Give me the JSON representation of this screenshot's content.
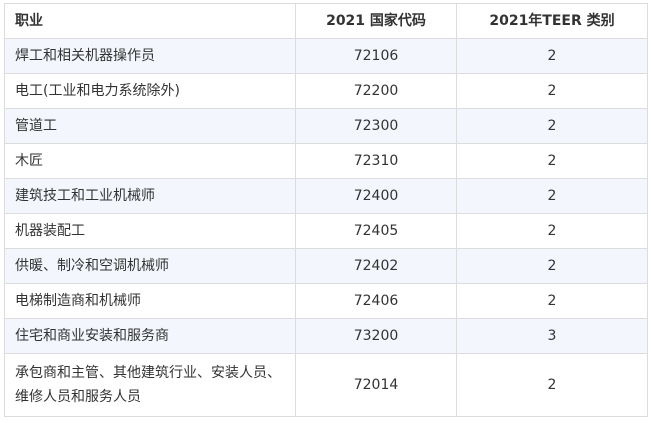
{
  "table": {
    "headers": {
      "occupation": "职业",
      "code": "2021 国家代码",
      "teer": "2021年TEER 类别"
    },
    "rows": [
      {
        "occupation": "焊工和相关机器操作员",
        "code": "72106",
        "teer": "2"
      },
      {
        "occupation": "电工(工业和电力系统除外)",
        "code": "72200",
        "teer": "2"
      },
      {
        "occupation": "管道工",
        "code": "72300",
        "teer": "2"
      },
      {
        "occupation": "木匠",
        "code": "72310",
        "teer": "2"
      },
      {
        "occupation": "建筑技工和工业机械师",
        "code": "72400",
        "teer": "2"
      },
      {
        "occupation": "机器装配工",
        "code": "72405",
        "teer": "2"
      },
      {
        "occupation": "供暖、制冷和空调机械师",
        "code": "72402",
        "teer": "2"
      },
      {
        "occupation": "电梯制造商和机械师",
        "code": "72406",
        "teer": "2"
      },
      {
        "occupation": "住宅和商业安装和服务商",
        "code": "73200",
        "teer": "3"
      },
      {
        "occupation": "承包商和主管、其他建筑行业、安装人员、维修人员和服务人员",
        "code": "72014",
        "teer": "2"
      }
    ]
  },
  "colors": {
    "stripe": "#f3f7fd",
    "border": "#dcdcdc",
    "text": "#333333"
  }
}
